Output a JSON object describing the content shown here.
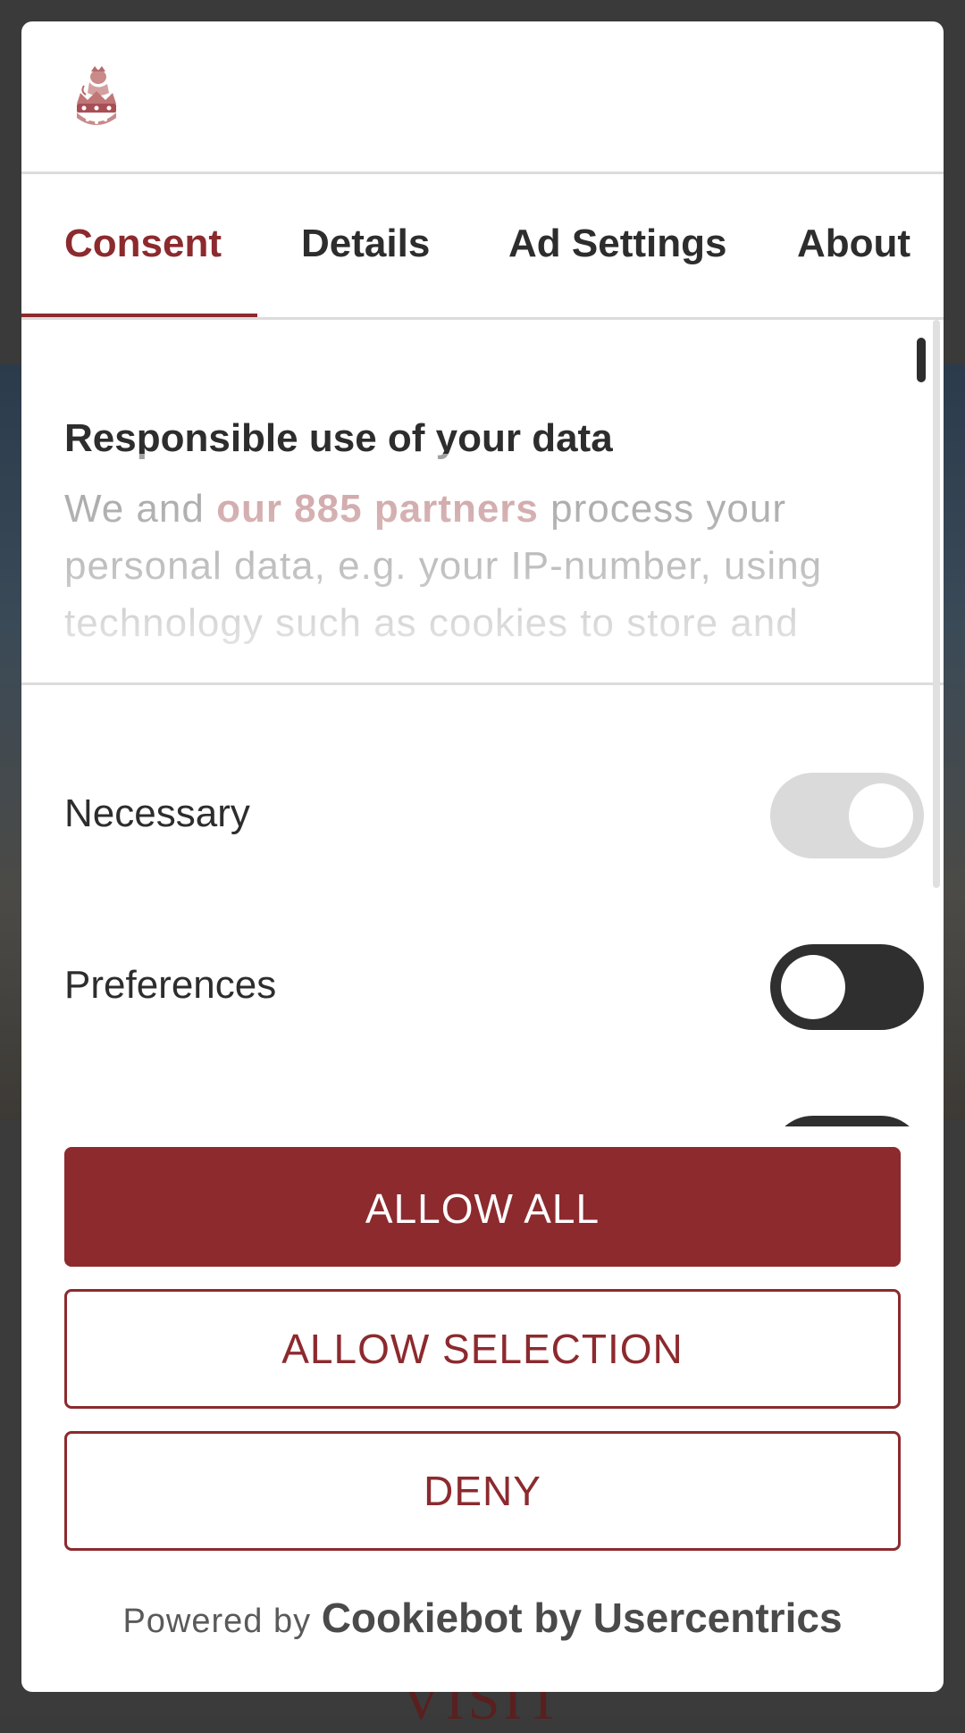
{
  "background": {
    "visit_text": "VISIT"
  },
  "dialog": {
    "logo_icon": "royal-crest-icon",
    "tabs": [
      {
        "label": "Consent",
        "active": true
      },
      {
        "label": "Details",
        "active": false
      },
      {
        "label": "Ad Settings",
        "active": false
      },
      {
        "label": "About",
        "active": false
      }
    ],
    "content": {
      "title": "Responsible use of your data",
      "body_prefix": "We and ",
      "partners_link": "our 885 partners",
      "body_suffix": " process your personal data, e.g. your IP-number, using technology such as cookies to store and"
    },
    "toggles": [
      {
        "label": "Necessary",
        "state": "on",
        "disabled": true
      },
      {
        "label": "Preferences",
        "state": "off",
        "disabled": false
      },
      {
        "label": "",
        "state": "off",
        "disabled": false
      }
    ],
    "buttons": {
      "allow_all": "ALLOW ALL",
      "allow_selection": "ALLOW SELECTION",
      "deny": "DENY"
    },
    "footer": {
      "prefix": "Powered by ",
      "brand": "Cookiebot by Usercentrics"
    }
  },
  "colors": {
    "accent": "#8c2a2e",
    "text": "#2d2d2d",
    "toggle_off": "#2f2f2f",
    "toggle_on_disabled": "#dadada"
  }
}
